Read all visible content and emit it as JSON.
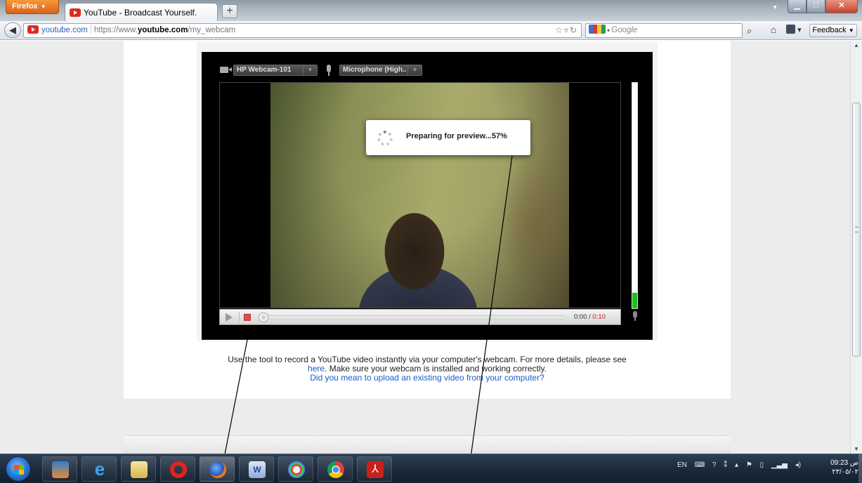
{
  "browser": {
    "menu_button_label": "Firefox",
    "tab_title": "YouTube - Broadcast Yourself.",
    "new_tab_label": "+",
    "url_domain": "youtube.com",
    "url_prefix": "https://www.",
    "url_host": "youtube.com",
    "url_path": "/my_webcam",
    "search_placeholder": "Google",
    "feedback_label": "Feedback"
  },
  "recorder": {
    "camera_select": "HP Webcam-101",
    "mic_select": "Microphone (High..",
    "preview_status": "Preparing for preview...57%",
    "preview_progress_percent": 57,
    "time_current": "0:00",
    "time_separator": " / ",
    "time_total": "0:10",
    "mic_level_percent": 7
  },
  "page": {
    "instruction_text_1": "Use the tool to record a YouTube video instantly via your computer's webcam. For more details, please see",
    "here_link": "here",
    "instruction_text_2": ". Make sure your webcam is installed and working correctly.",
    "upload_link": "Did you mean to upload an existing video from your computer?"
  },
  "taskbar": {
    "language": "EN",
    "clock_time": "09:23 ص",
    "clock_date": "٢٣/٠٥/٠٢",
    "apps": [
      "media-player",
      "internet-explorer",
      "file-explorer",
      "opera",
      "firefox",
      "word",
      "paint",
      "chrome",
      "acrobat"
    ]
  },
  "colors": {
    "youtube_red": "#e02a20",
    "link_blue": "#1a5cc8",
    "meter_green": "#1cc21c",
    "stop_red": "#e34b4b"
  }
}
